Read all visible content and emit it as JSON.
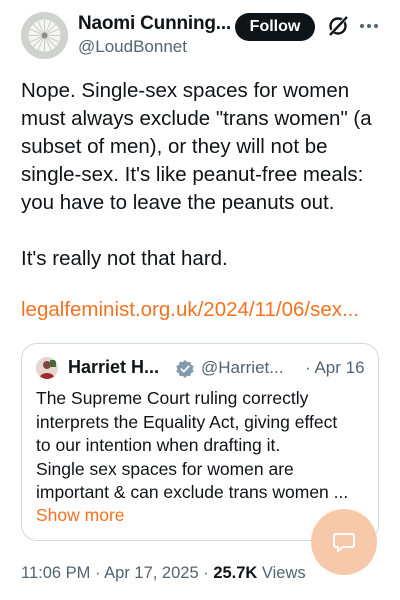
{
  "author": {
    "name": "Naomi Cunning...",
    "handle": "@LoudBonnet",
    "avatar_icon": "dandelion-avatar"
  },
  "actions": {
    "follow_label": "Follow",
    "grok_icon": "grok-icon",
    "more_icon": "more-dots-icon"
  },
  "tweet": {
    "lines": [
      "Nope. Single-sex spaces for women",
      "must always exclude \"trans women\" (a",
      "subset of men), or they will not be",
      "single-sex. It's like peanut-free meals:",
      "you have to leave the peanuts out."
    ],
    "line2": "It's really not that hard.",
    "link": "legalfeminist.org.uk/2024/11/06/sex..."
  },
  "quote": {
    "name": "Harriet H...",
    "handle": "@Harriet...",
    "date": "· Apr 16",
    "verified_icon": "verified-badge-icon",
    "lines": [
      "The Supreme Court ruling correctly",
      "interprets the Equality Act, giving effect",
      "to our intention when drafting it.",
      "Single sex spaces for women are",
      "important & can exclude trans women ..."
    ],
    "show_more": "Show more"
  },
  "meta": {
    "time_date": "11:06 PM · Apr 17, 2025 · ",
    "views_count": "25.7K",
    "views_label": " Views"
  },
  "colors": {
    "accent": "#f4721f",
    "fab": "#f7c7a6",
    "text": "#0f1419",
    "secondary": "#536471",
    "border": "#cfd9de"
  }
}
